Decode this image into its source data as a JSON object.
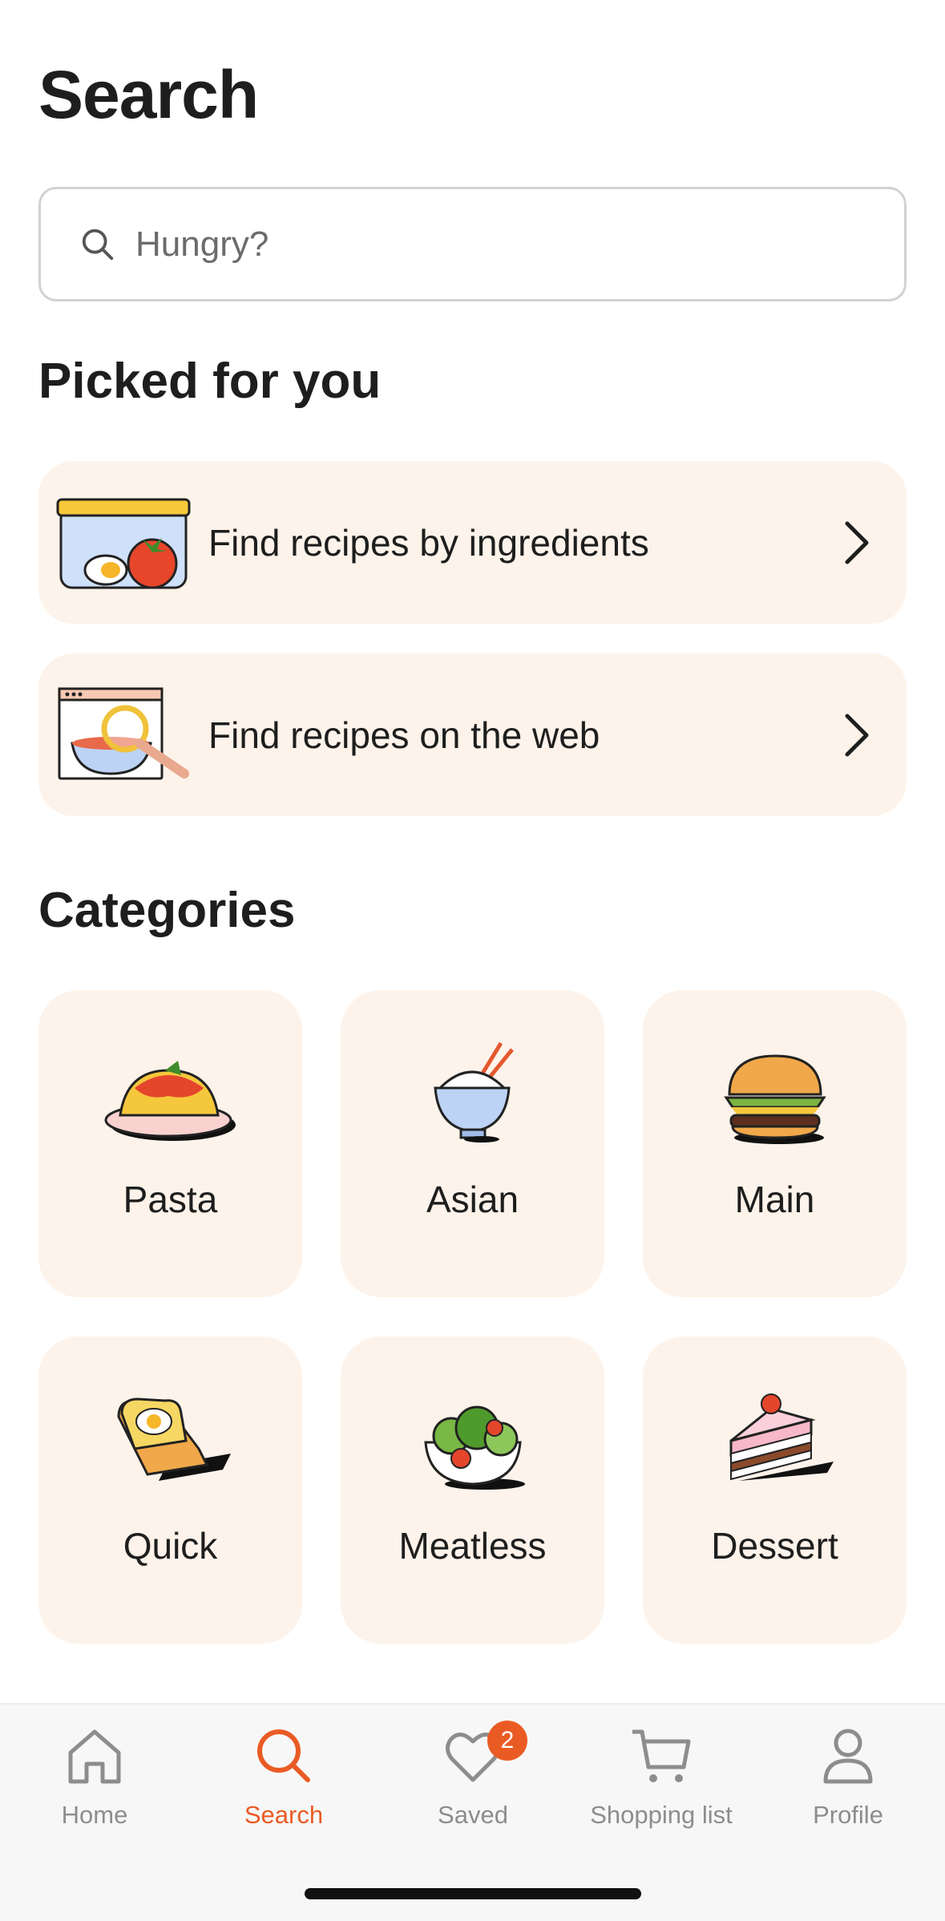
{
  "header": {
    "title": "Search"
  },
  "search": {
    "placeholder": "Hungry?"
  },
  "picked": {
    "title": "Picked for you",
    "items": [
      {
        "label": "Find recipes by ingredients",
        "icon": "food-container-illustration"
      },
      {
        "label": "Find recipes on the web",
        "icon": "web-search-bowl-illustration"
      }
    ]
  },
  "categories": {
    "title": "Categories",
    "items": [
      {
        "label": "Pasta",
        "icon": "pasta-illustration"
      },
      {
        "label": "Asian",
        "icon": "rice-bowl-illustration"
      },
      {
        "label": "Main",
        "icon": "burger-illustration"
      },
      {
        "label": "Quick",
        "icon": "toast-egg-illustration"
      },
      {
        "label": "Meatless",
        "icon": "salad-illustration"
      },
      {
        "label": "Dessert",
        "icon": "cake-slice-illustration"
      }
    ]
  },
  "tabbar": {
    "tabs": [
      {
        "label": "Home",
        "icon": "home-icon"
      },
      {
        "label": "Search",
        "icon": "search-icon",
        "active": true
      },
      {
        "label": "Saved",
        "icon": "heart-icon",
        "badge": "2"
      },
      {
        "label": "Shopping list",
        "icon": "cart-icon"
      },
      {
        "label": "Profile",
        "icon": "person-icon"
      }
    ]
  },
  "colors": {
    "accent": "#ea5b24",
    "card_bg": "#fdf3ea",
    "inactive": "#8d8d8d"
  }
}
